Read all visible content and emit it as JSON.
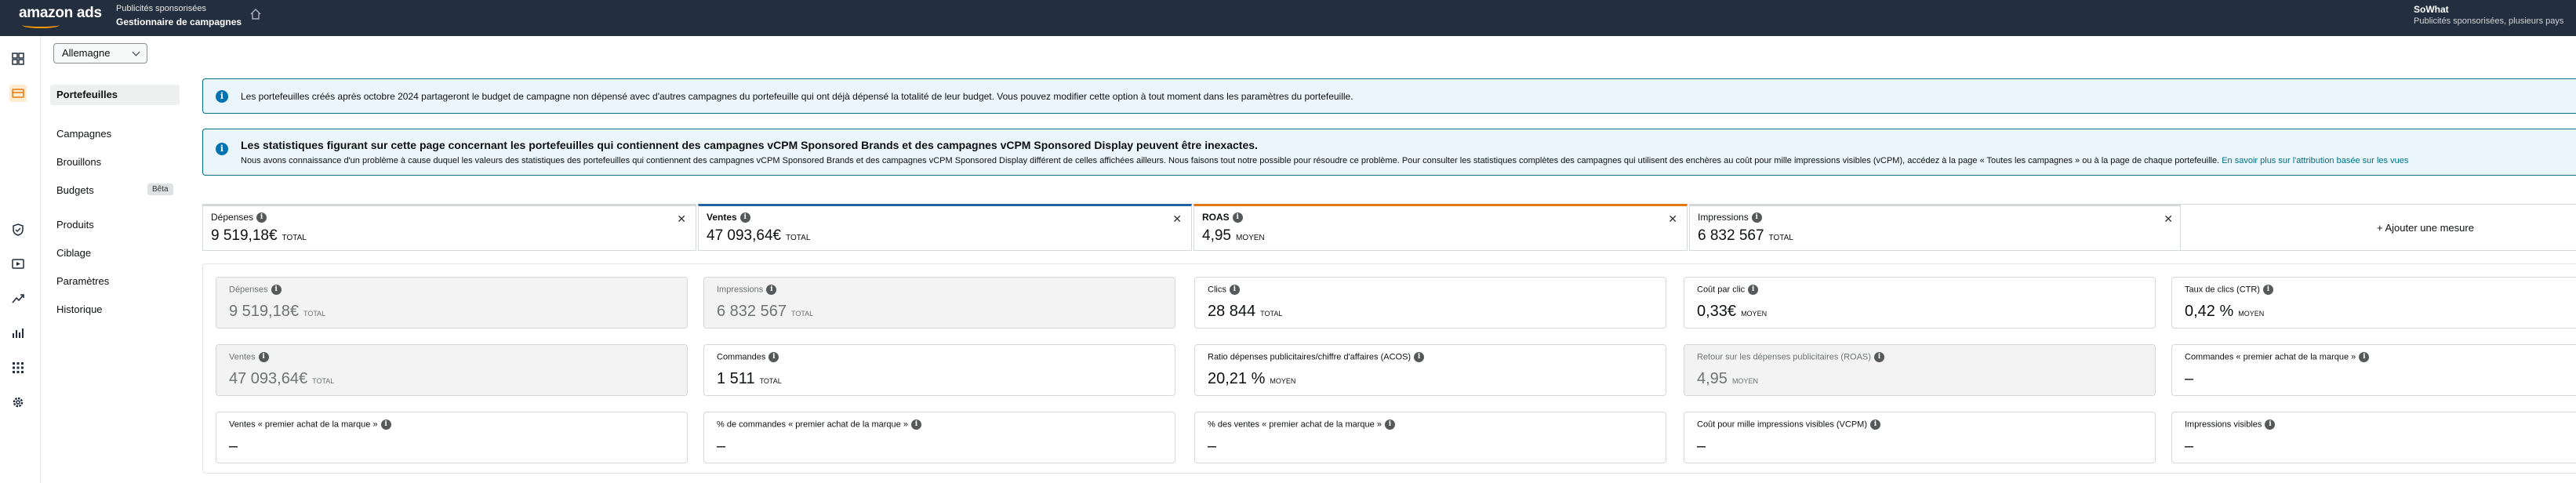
{
  "header": {
    "logo_text": "amazon ads",
    "app_sub": "Publicités sponsorisées",
    "app_title": "Gestionnaire de campagnes",
    "account_name": "SoWhat",
    "account_sub": "Publicités sponsorisées, plusieurs pays"
  },
  "country_select": {
    "value": "Allemagne"
  },
  "sidebar": {
    "items": [
      {
        "label": "Portefeuilles"
      },
      {
        "label": "Campagnes"
      },
      {
        "label": "Brouillons"
      },
      {
        "label": "Budgets",
        "badge": "Bêta"
      },
      {
        "label": "Produits"
      },
      {
        "label": "Ciblage"
      },
      {
        "label": "Paramètres"
      },
      {
        "label": "Historique"
      }
    ]
  },
  "alerts": {
    "budget": "Les portefeuilles créés après octobre 2024 partageront le budget de campagne non dépensé avec d'autres campagnes du portefeuille qui ont déjà dépensé la totalité de leur budget. Vous pouvez modifier cette option à tout moment dans les paramètres du portefeuille.",
    "stats_title": "Les statistiques figurant sur cette page concernant les portefeuilles qui contiennent des campagnes vCPM Sponsored Brands et des campagnes vCPM Sponsored Display peuvent être inexactes.",
    "stats_text": "Nous avons connaissance d'un problème à cause duquel les valeurs des statistiques des portefeuilles qui contiennent des campagnes vCPM Sponsored Brands et des campagnes vCPM Sponsored Display différent de celles affichées ailleurs. Nous faisons tout notre possible pour résoudre ce problème. Pour consulter les statistiques complètes des campagnes qui utilisent des enchères au coût pour mille impressions visibles (vCPM), accédez à la page « Toutes les campagnes » ou à la page de chaque portefeuille.",
    "stats_link": "En savoir plus sur l'attribution basée sur les vues"
  },
  "selected_metrics": [
    {
      "label": "Dépenses",
      "value": "9 519,18€",
      "unit": "TOTAL",
      "color": "#d5d9d9"
    },
    {
      "label": "Ventes",
      "value": "47 093,64€",
      "unit": "TOTAL",
      "color": "#2162a1"
    },
    {
      "label": "ROAS",
      "value": "4,95",
      "unit": "MOYEN",
      "color": "#e47911"
    },
    {
      "label": "Impressions",
      "value": "6 832 567",
      "unit": "TOTAL",
      "color": "#d5d9d9"
    }
  ],
  "add_metric_label": "+ Ajouter une mesure",
  "metric_grid": [
    {
      "label": "Dépenses",
      "value": "9 519,18€",
      "unit": "TOTAL",
      "dim": true
    },
    {
      "label": "Impressions",
      "value": "6 832 567",
      "unit": "TOTAL",
      "dim": true
    },
    {
      "label": "Clics",
      "value": "28 844",
      "unit": "TOTAL",
      "dim": false
    },
    {
      "label": "Coût par clic",
      "value": "0,33€",
      "unit": "MOYEN",
      "dim": false
    },
    {
      "label": "Taux de clics (CTR)",
      "value": "0,42 %",
      "unit": "MOYEN",
      "dim": false
    },
    {
      "label": "Ventes",
      "value": "47 093,64€",
      "unit": "TOTAL",
      "dim": true
    },
    {
      "label": "Commandes",
      "value": "1 511",
      "unit": "TOTAL",
      "dim": false
    },
    {
      "label": "Ratio dépenses publicitaires/chiffre d'affaires (ACOS)",
      "value": "20,21 %",
      "unit": "MOYEN",
      "dim": false
    },
    {
      "label": "Retour sur les dépenses publicitaires (ROAS)",
      "value": "4,95",
      "unit": "MOYEN",
      "dim": true
    },
    {
      "label": "Commandes « premier achat de la marque »",
      "value": "–",
      "unit": "",
      "dim": false
    },
    {
      "label": "Ventes « premier achat de la marque »",
      "value": "–",
      "unit": "",
      "dim": false
    },
    {
      "label": "% de commandes « premier achat de la marque »",
      "value": "–",
      "unit": "",
      "dim": false
    },
    {
      "label": "% des ventes « premier achat de la marque »",
      "value": "–",
      "unit": "",
      "dim": false
    },
    {
      "label": "Coût pour mille impressions visibles (VCPM)",
      "value": "–",
      "unit": "",
      "dim": false
    },
    {
      "label": "Impressions visibles",
      "value": "–",
      "unit": "",
      "dim": false
    }
  ],
  "icons": {
    "rail": [
      "dashboard-icon",
      "campaign-manager-icon",
      "shield-icon",
      "media-icon",
      "trend-icon",
      "reports-icon",
      "apps-icon",
      "settings-icon"
    ]
  }
}
